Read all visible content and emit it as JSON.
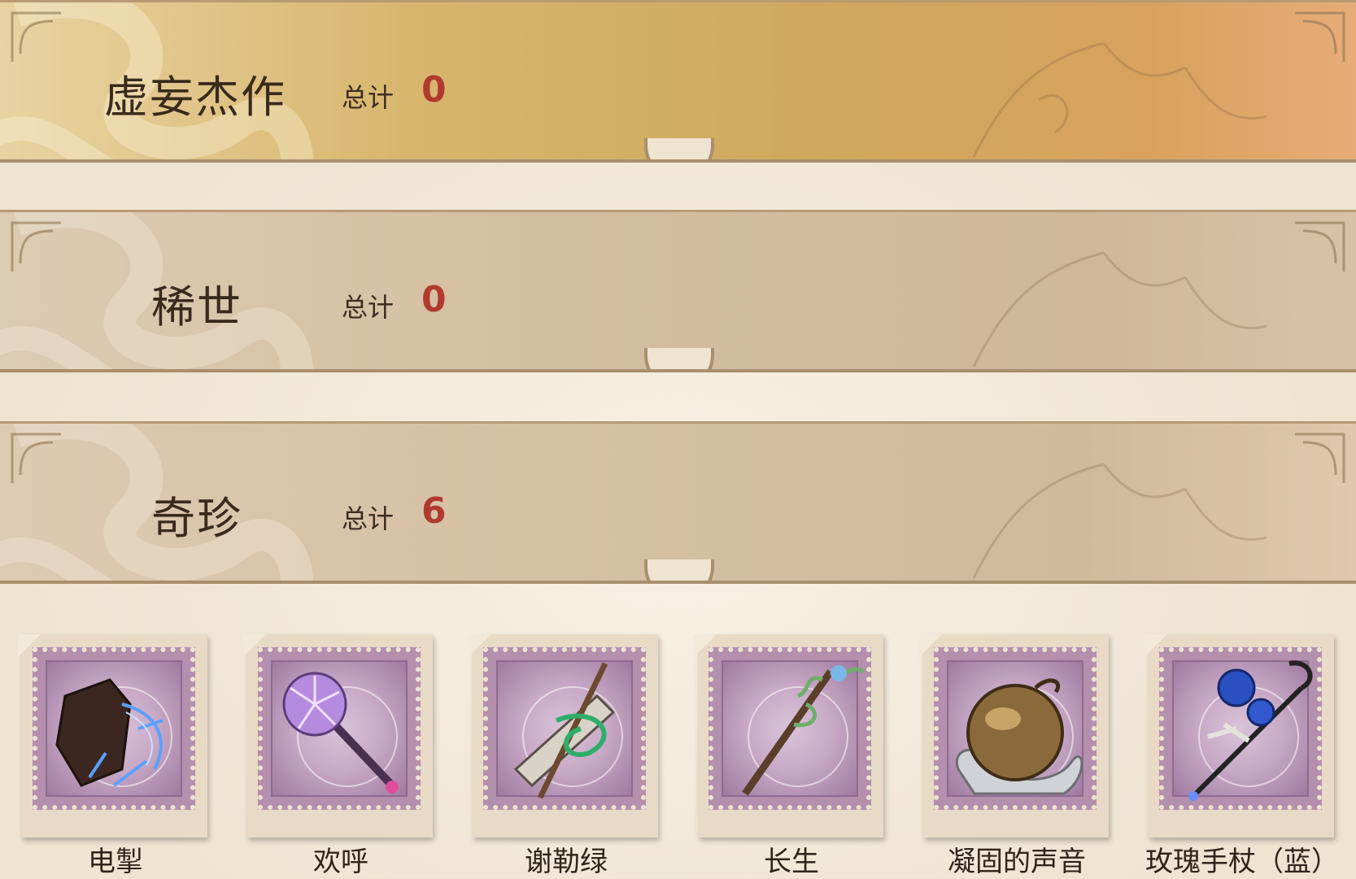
{
  "sections": [
    {
      "title": "虚妄杰作",
      "total_label": "总计",
      "total": "0"
    },
    {
      "title": "稀世",
      "total_label": "总计",
      "total": "0"
    },
    {
      "title": "奇珍",
      "total_label": "总计",
      "total": "6"
    }
  ],
  "items": [
    {
      "name": "电掣",
      "icon": "electric-gauntlet-icon"
    },
    {
      "name": "欢呼",
      "icon": "purple-scepter-icon"
    },
    {
      "name": "谢勒绿",
      "icon": "green-staff-icon"
    },
    {
      "name": "长生",
      "icon": "vine-staff-icon"
    },
    {
      "name": "凝固的声音",
      "icon": "bronze-orb-icon"
    },
    {
      "name": "玫瑰手杖（蓝）",
      "icon": "blue-rose-cane-icon"
    }
  ],
  "colors": {
    "total_value": "#b13a2e",
    "stamp": "#b58fae"
  }
}
